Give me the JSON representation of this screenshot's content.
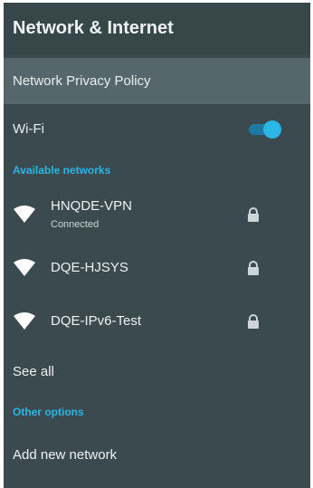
{
  "header": {
    "title": "Network & Internet"
  },
  "policy": {
    "label": "Network Privacy Policy"
  },
  "wifi": {
    "label": "Wi-Fi",
    "enabled": true
  },
  "available": {
    "title": "Available networks",
    "networks": [
      {
        "ssid": "HNQDE-VPN",
        "status": "Connected",
        "icon": "wifi-icon",
        "lock_icon": "lock-icon"
      },
      {
        "ssid": "DQE-HJSYS",
        "icon": "wifi-icon",
        "lock_icon": "lock-icon"
      },
      {
        "ssid": "DQE-IPv6-Test",
        "icon": "wifi-icon",
        "lock_icon": "lock-icon"
      }
    ],
    "see_all": "See all"
  },
  "other": {
    "title": "Other options",
    "add_network": "Add new network"
  },
  "colors": {
    "background": "#3a4a4f",
    "header": "#374649",
    "selected_row": "#56676b",
    "accent": "#2bb6e6",
    "text": "#eef2f2"
  }
}
